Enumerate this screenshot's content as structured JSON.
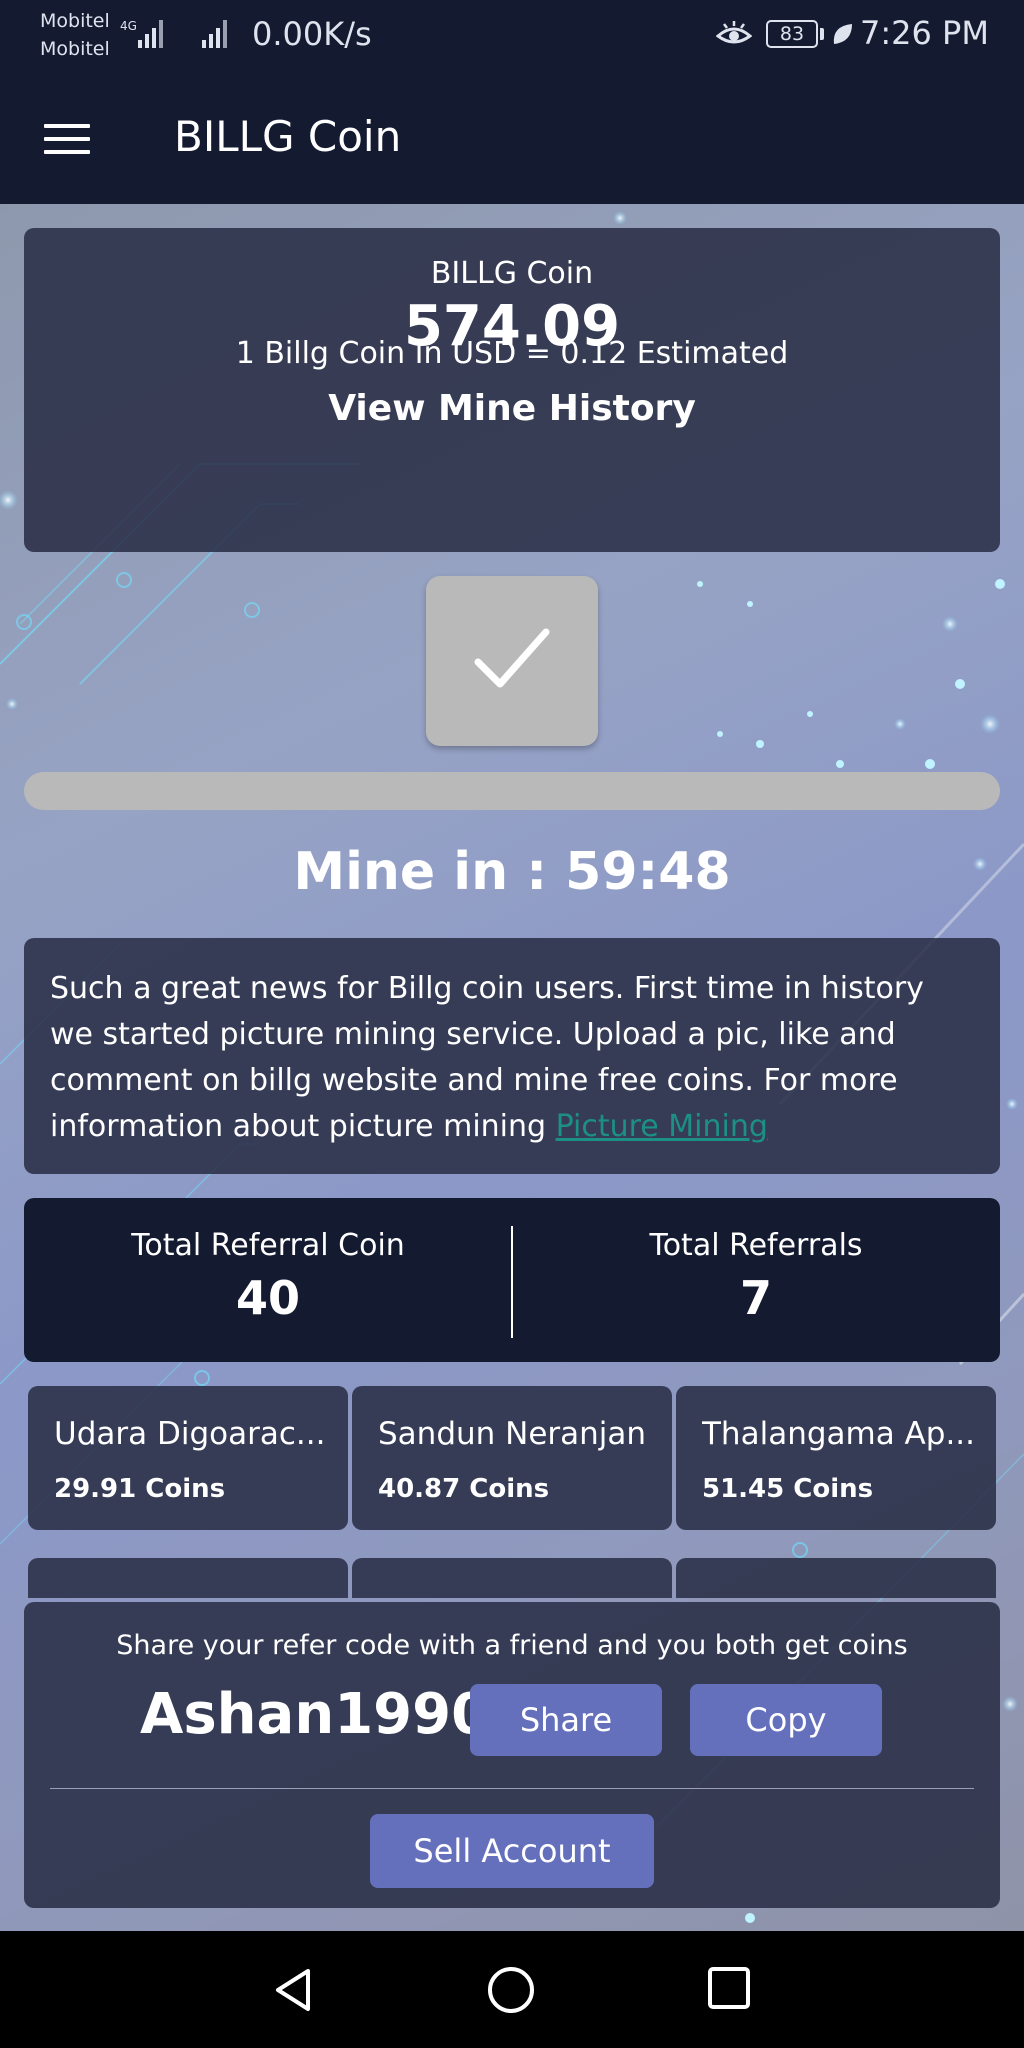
{
  "status_bar": {
    "carrier1": "Mobitel",
    "carrier2": "Mobitel",
    "network_type": "4G",
    "net_speed": "0.00K/s",
    "battery": "83",
    "time": "7:26 PM"
  },
  "app_bar": {
    "title": "BILLG Coin"
  },
  "balance": {
    "coin_name": "BILLG Coin",
    "amount": "574.09",
    "rate_text": "1 Billg Coin In USD = 0.12 Estimated",
    "history_label": "View Mine History"
  },
  "mining": {
    "progress": 1.0,
    "timer_text": "Mine in : 59:48"
  },
  "news": {
    "text": "Such a great news for Billg coin users. First time in history we started picture mining service. Upload a pic, like and comment on billg website and mine free coins. For more information about picture mining ",
    "link_text": "Picture Mining"
  },
  "referral": {
    "coin_label": "Total Referral Coin",
    "coin_value": "40",
    "count_label": "Total Referrals",
    "count_value": "7"
  },
  "referral_users": [
    {
      "name": "Udara Digoarac...",
      "coins": "29.91 Coins"
    },
    {
      "name": "Sandun Neranjan",
      "coins": "40.87 Coins"
    },
    {
      "name": "Thalangama Ap...",
      "coins": "51.45 Coins"
    }
  ],
  "refer": {
    "message": "Share your refer code with a friend and you both get coins",
    "code": "Ashan1990",
    "share_label": "Share",
    "copy_label": "Copy",
    "sell_label": "Sell Account"
  },
  "colors": {
    "appbar": "#141a30",
    "button": "#6570bd",
    "link": "#1c8f86",
    "mine_button": "#b9b9b9"
  }
}
